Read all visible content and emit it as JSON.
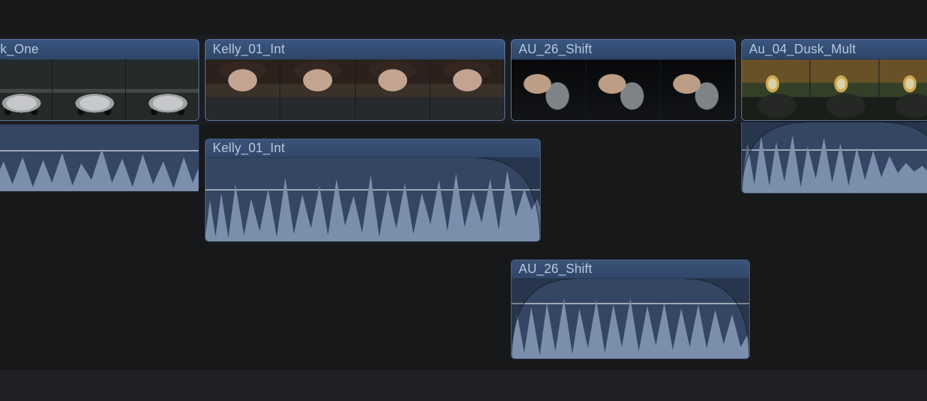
{
  "timeline": {
    "clips": [
      {
        "id": "usk-one",
        "label": "usk_One"
      },
      {
        "id": "kelly-vid",
        "label": "Kelly_01_Int"
      },
      {
        "id": "au26-vid",
        "label": "AU_26_Shift"
      },
      {
        "id": "au04-vid",
        "label": "Au_04_Dusk_Mult"
      }
    ],
    "audio": [
      {
        "id": "kelly-aud",
        "label": "Kelly_01_Int"
      },
      {
        "id": "au26-aud",
        "label": "AU_26_Shift"
      }
    ]
  }
}
